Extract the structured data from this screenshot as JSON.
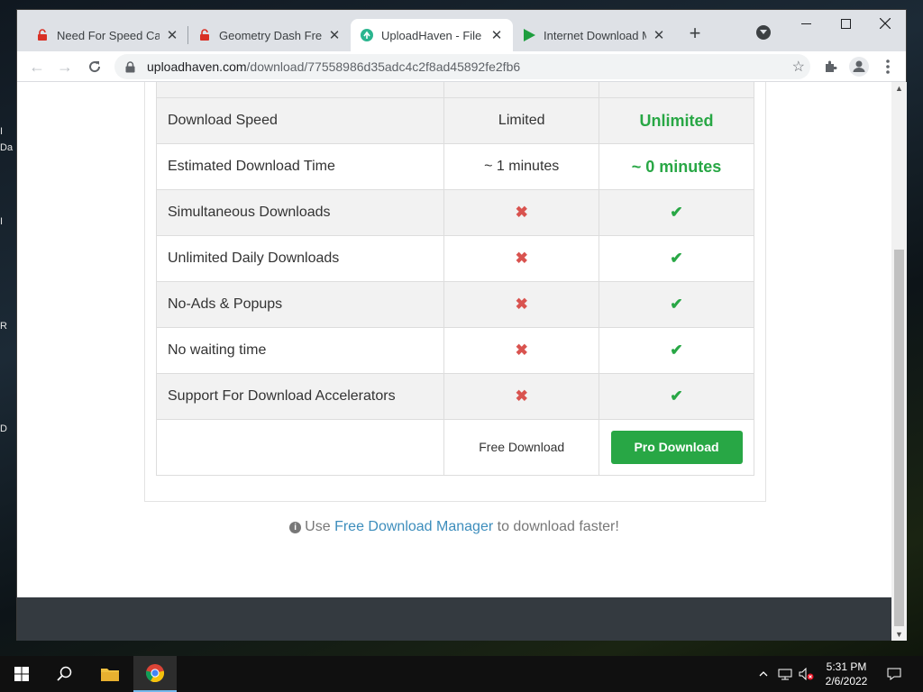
{
  "desktop": {
    "fragments": [
      "I",
      "Da",
      "I",
      "R",
      "D"
    ]
  },
  "tabs": [
    {
      "title": "Need For Speed Carb",
      "icon": "lock-icon-red",
      "active": false
    },
    {
      "title": "Geometry Dash Free F",
      "icon": "lock-icon-red",
      "active": false
    },
    {
      "title": "UploadHaven - File Sh",
      "icon": "uploadhaven-icon",
      "active": true
    },
    {
      "title": "Internet Download Ma",
      "icon": "play-icon-green",
      "active": false
    }
  ],
  "address_bar": {
    "host": "uploadhaven.com",
    "path": "/download/77558986d35adc4c2f8ad45892fe2fb6"
  },
  "comparison": {
    "rows": [
      {
        "feature": "Download Speed",
        "free": "Limited",
        "pro": "Unlimited",
        "type": "text",
        "shade": true
      },
      {
        "feature": "Estimated Download Time",
        "free": "~ 1 minutes",
        "pro": "~ 0 minutes",
        "type": "text",
        "shade": false
      },
      {
        "feature": "Simultaneous Downloads",
        "free": "no",
        "pro": "yes",
        "type": "icon",
        "shade": true
      },
      {
        "feature": "Unlimited Daily Downloads",
        "free": "no",
        "pro": "yes",
        "type": "icon",
        "shade": false
      },
      {
        "feature": "No-Ads & Popups",
        "free": "no",
        "pro": "yes",
        "type": "icon",
        "shade": true
      },
      {
        "feature": "No waiting time",
        "free": "no",
        "pro": "yes",
        "type": "icon",
        "shade": false
      },
      {
        "feature": "Support For Download Accelerators",
        "free": "no",
        "pro": "yes",
        "type": "icon",
        "shade": true
      }
    ],
    "free_download_label": "Free Download",
    "pro_download_label": "Pro Download"
  },
  "fdm_note": {
    "prefix": "Use ",
    "link": "Free Download Manager",
    "suffix": " to download faster!"
  },
  "taskbar": {
    "time": "5:31 PM",
    "date": "2/6/2022"
  },
  "colors": {
    "accent_green": "#28a745",
    "cross_red": "#d9534f",
    "link_blue": "#3c8dbc",
    "footer_dark": "#343a40"
  }
}
